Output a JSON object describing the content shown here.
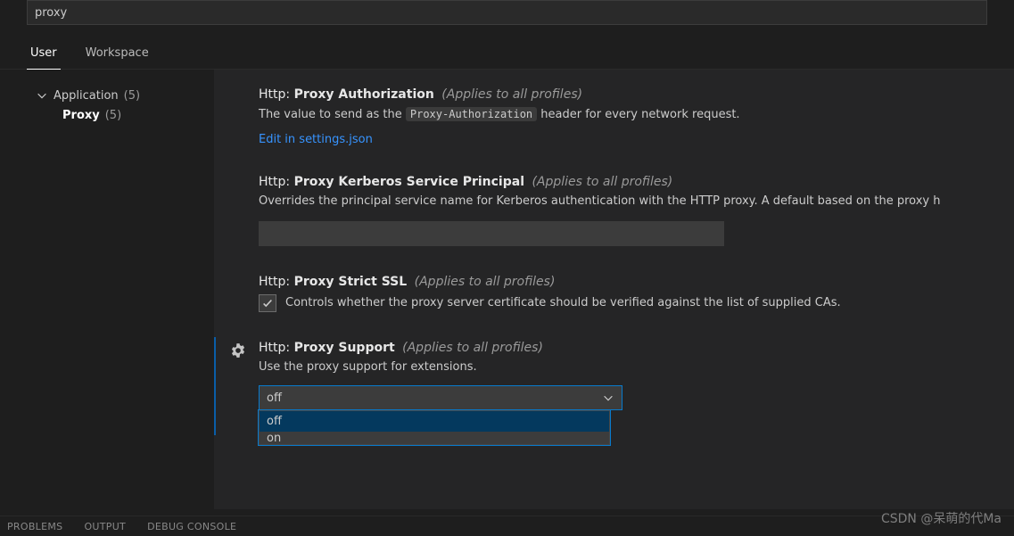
{
  "search": {
    "value": "proxy"
  },
  "scopeTabs": {
    "user": "User",
    "workspace": "Workspace"
  },
  "tree": {
    "group": {
      "label": "Application",
      "count": "(5)"
    },
    "child": {
      "label": "Proxy",
      "count": "(5)"
    }
  },
  "settings": {
    "scopeNote": "(Applies to all profiles)",
    "prefix": "Http:",
    "proxyAuth": {
      "name": "Proxy Authorization",
      "descBefore": "The value to send as the ",
      "descCode": "Proxy-Authorization",
      "descAfter": " header for every network request.",
      "editLink": "Edit in settings.json"
    },
    "kerberos": {
      "name": "Proxy Kerberos Service Principal",
      "desc": "Overrides the principal service name for Kerberos authentication with the HTTP proxy. A default based on the proxy h"
    },
    "strictSsl": {
      "name": "Proxy Strict SSL",
      "desc": "Controls whether the proxy server certificate should be verified against the list of supplied CAs."
    },
    "proxySupport": {
      "name": "Proxy Support",
      "desc": "Use the proxy support for extensions.",
      "selected": "off",
      "options": {
        "o0": "off",
        "o1": "on"
      }
    }
  },
  "panels": {
    "problems": "PROBLEMS",
    "output": "OUTPUT",
    "debug": "DEBUG CONSOLE"
  },
  "watermark": "CSDN @呆萌的代Ma"
}
